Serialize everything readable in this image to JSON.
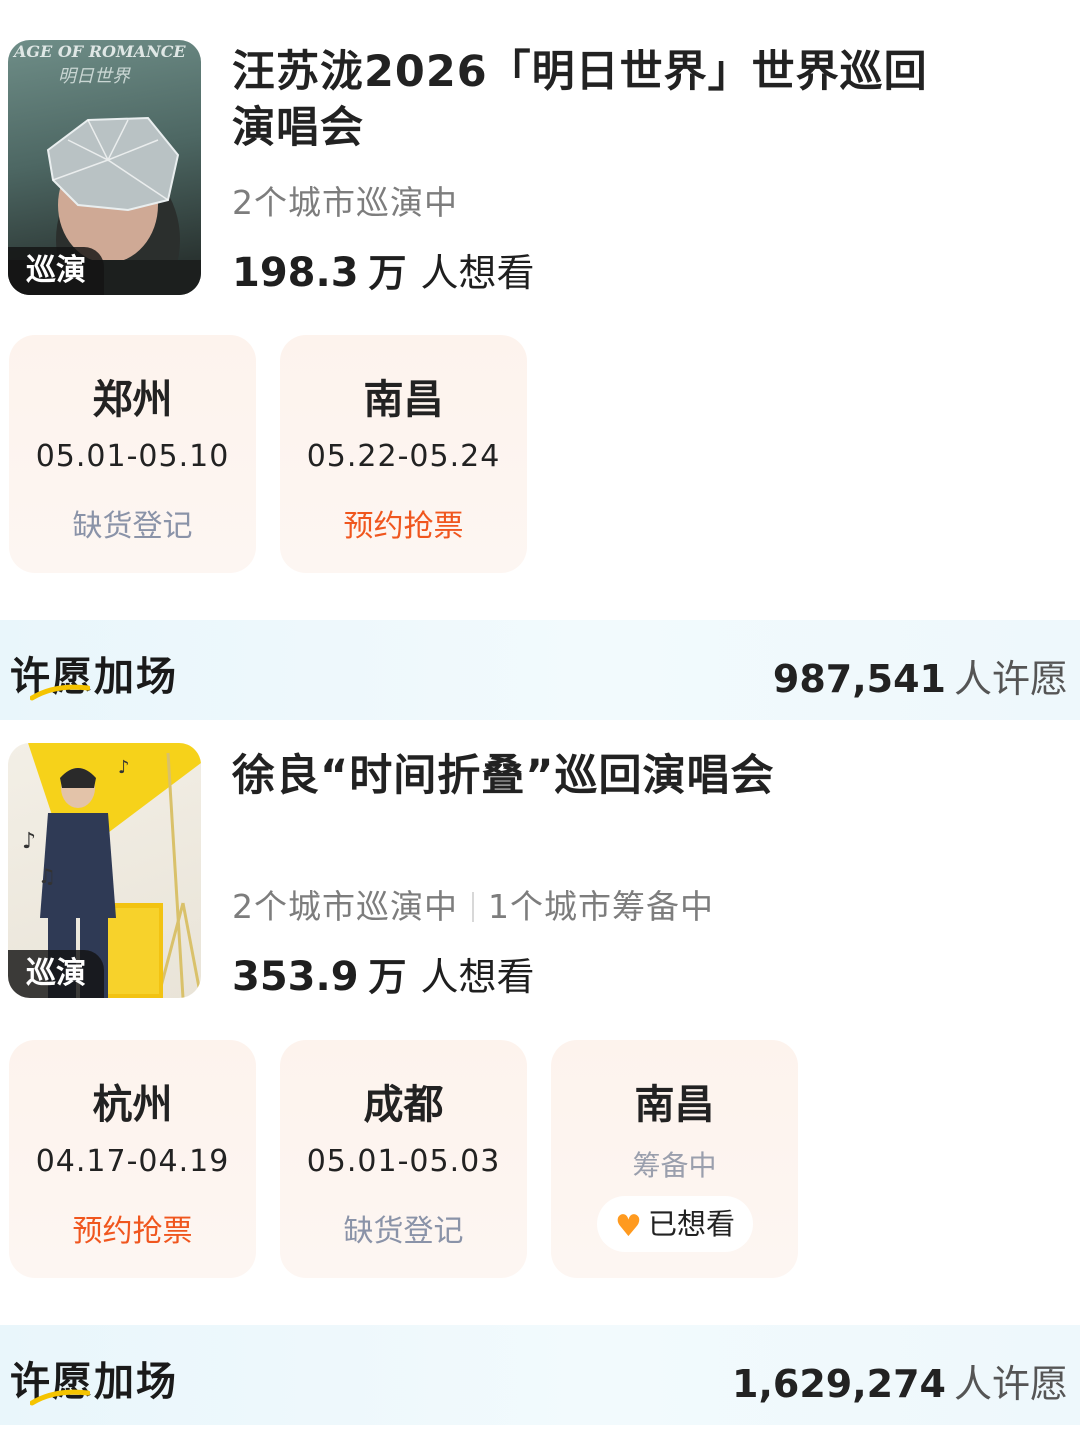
{
  "events": [
    {
      "poster_tag": "巡演",
      "poster_brand": "AGE OF ROMANCE",
      "title": "汪苏泷2026「明日世界」世界巡回演唱会",
      "cities_touring": "2个城市巡演中",
      "cities_preparing": "",
      "want_num": "198.3",
      "want_unit": "万",
      "want_text": "人想看",
      "cities": [
        {
          "city": "郑州",
          "date": "05.01-05.10",
          "status": "缺货登记",
          "status_type": "gray"
        },
        {
          "city": "南昌",
          "date": "05.22-05.24",
          "status": "预约抢票",
          "status_type": "orange"
        }
      ],
      "wish": {
        "label": "许愿加场",
        "count": "987,541",
        "count_label": "人许愿"
      }
    },
    {
      "poster_tag": "巡演",
      "title": "徐良“时间折叠”巡回演唱会",
      "cities_touring": "2个城市巡演中",
      "cities_preparing": "1个城市筹备中",
      "want_num": "353.9",
      "want_unit": "万",
      "want_text": "人想看",
      "cities": [
        {
          "city": "杭州",
          "date": "04.17-04.19",
          "status": "预约抢票",
          "status_type": "orange"
        },
        {
          "city": "成都",
          "date": "05.01-05.03",
          "status": "缺货登记",
          "status_type": "gray"
        },
        {
          "city": "南昌",
          "prep": "筹备中",
          "button": "已想看"
        }
      ],
      "wish": {
        "label": "许愿加场",
        "count": "1,629,274",
        "count_label": "人许愿"
      }
    }
  ],
  "colors": {
    "accent_orange": "#f0561e",
    "muted_gray": "#8a93a8",
    "heart": "#ff9a1f",
    "wish_bg": "#e9f6fb"
  },
  "icons": {
    "want_button": "heart-icon"
  }
}
